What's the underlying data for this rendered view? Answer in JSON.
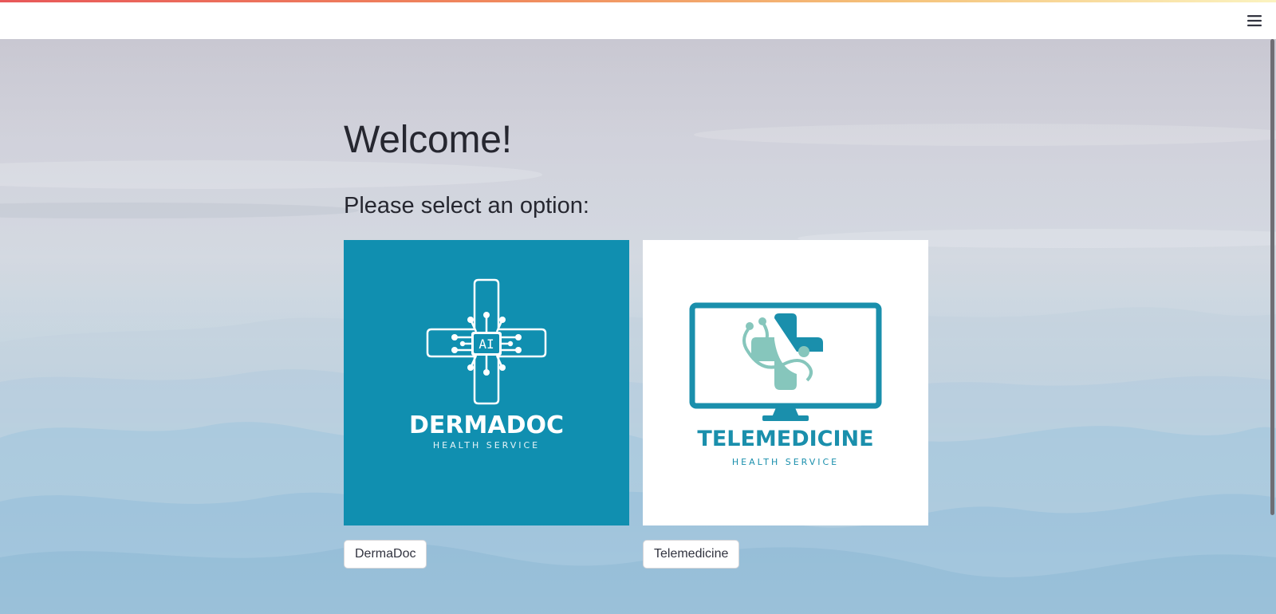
{
  "colors": {
    "accent_gradient": [
      "#e8585a",
      "#f5c27a"
    ],
    "derma_teal": "#108fb0",
    "tele_teal": "#1a8fac",
    "tele_mint": "#86c6bc",
    "text_dark": "#262730"
  },
  "header": {
    "menu_icon": "hamburger-menu-icon"
  },
  "main": {
    "title": "Welcome!",
    "subtitle": "Please select an option:",
    "options": [
      {
        "logo_title": "DERMADOC",
        "logo_subtitle": "HEALTH SERVICE",
        "logo_badge": "AI",
        "button_label": "DermaDoc"
      },
      {
        "logo_title": "TELEMEDICINE",
        "logo_subtitle": "HEALTH SERVICE",
        "button_label": "Telemedicine"
      }
    ]
  }
}
